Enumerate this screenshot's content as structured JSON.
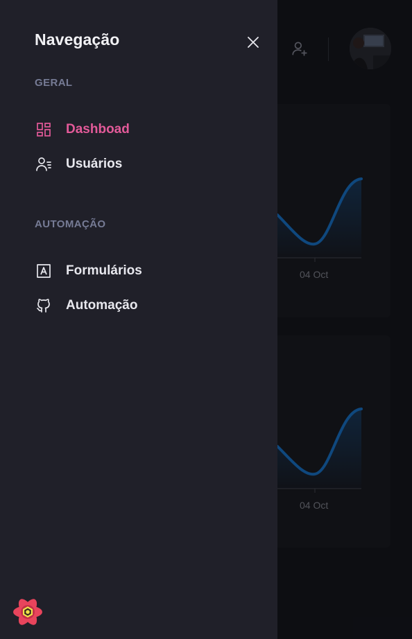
{
  "drawer": {
    "title": "Navegação",
    "sections": [
      {
        "label": "GERAL",
        "items": [
          {
            "label": "Dashboad",
            "icon": "dashboard-icon",
            "active": true
          },
          {
            "label": "Usuários",
            "icon": "users-list-icon",
            "active": false
          }
        ]
      },
      {
        "label": "AUTOMAÇÃO",
        "items": [
          {
            "label": "Formulários",
            "icon": "form-icon",
            "active": false
          },
          {
            "label": "Automação",
            "icon": "github-icon",
            "active": false
          }
        ]
      }
    ]
  },
  "background": {
    "charts": [
      {
        "tick_partial": "ct",
        "tick_label": "04 Oct"
      },
      {
        "tick_partial": "ct",
        "tick_label": "04 Oct"
      }
    ]
  },
  "colors": {
    "accent": "#e35a99",
    "drawer_bg": "#202029",
    "chart_line": "#1560a8",
    "section_label": "#767b95"
  }
}
